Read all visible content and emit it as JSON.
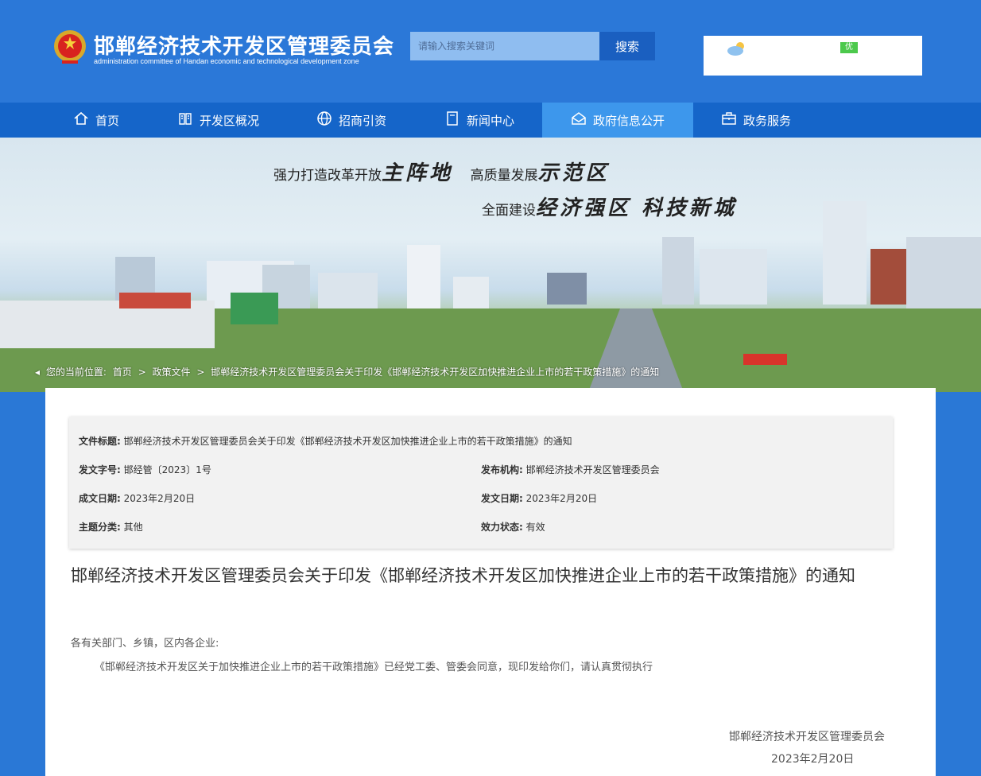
{
  "header": {
    "title": "邯郸经济技术开发区管理委员会",
    "subtitle": "administration committee of Handan economic and technological development zone",
    "search_placeholder": "请输入搜索关键词",
    "search_button": "搜索",
    "weather_aqi": "优"
  },
  "nav": {
    "items": [
      {
        "label": "首页",
        "icon": "home-icon"
      },
      {
        "label": "开发区概况",
        "icon": "book-icon"
      },
      {
        "label": "招商引资",
        "icon": "globe-icon"
      },
      {
        "label": "新闻中心",
        "icon": "document-icon"
      },
      {
        "label": "政府信息公开",
        "icon": "mailbox-icon",
        "active": true
      },
      {
        "label": "政务服务",
        "icon": "briefcase-icon"
      }
    ]
  },
  "banner": {
    "slogan1_prefix": "强力打造改革开放",
    "slogan1_bold": "主阵地",
    "slogan1b_prefix": "高质量发展",
    "slogan1b_bold": "示范区",
    "slogan2_prefix": "全面建设",
    "slogan2_bold": "经济强区  科技新城"
  },
  "breadcrumb": {
    "prefix": "您的当前位置:",
    "items": [
      "首页",
      "政策文件",
      "邯郸经济技术开发区管理委员会关于印发《邯郸经济技术开发区加快推进企业上市的若干政策措施》的通知"
    ],
    "sep": ">"
  },
  "meta": {
    "title_label": "文件标题:",
    "title_value": "邯郸经济技术开发区管理委员会关于印发《邯郸经济技术开发区加快推进企业上市的若干政策措施》的通知",
    "docno_label": "发文字号:",
    "docno_value": "邯经管〔2023〕1号",
    "issuer_label": "发布机构:",
    "issuer_value": "邯郸经济技术开发区管理委员会",
    "written_label": "成文日期:",
    "written_value": "2023年2月20日",
    "issued_label": "发文日期:",
    "issued_value": "2023年2月20日",
    "topic_label": "主题分类:",
    "topic_value": "其他",
    "status_label": "效力状态:",
    "status_value": "有效"
  },
  "doc": {
    "title": "邯郸经济技术开发区管理委员会关于印发《邯郸经济技术开发区加快推进企业上市的若干政策措施》的通知",
    "greeting": "各有关部门、乡镇，区内各企业:",
    "body": "《邯郸经济技术开发区关于加快推进企业上市的若干政策措施》已经党工委、管委会同意，现印发给你们，请认真贯彻执行",
    "sign_org": "邯郸经济技术开发区管理委员会",
    "sign_date": "2023年2月20日"
  }
}
